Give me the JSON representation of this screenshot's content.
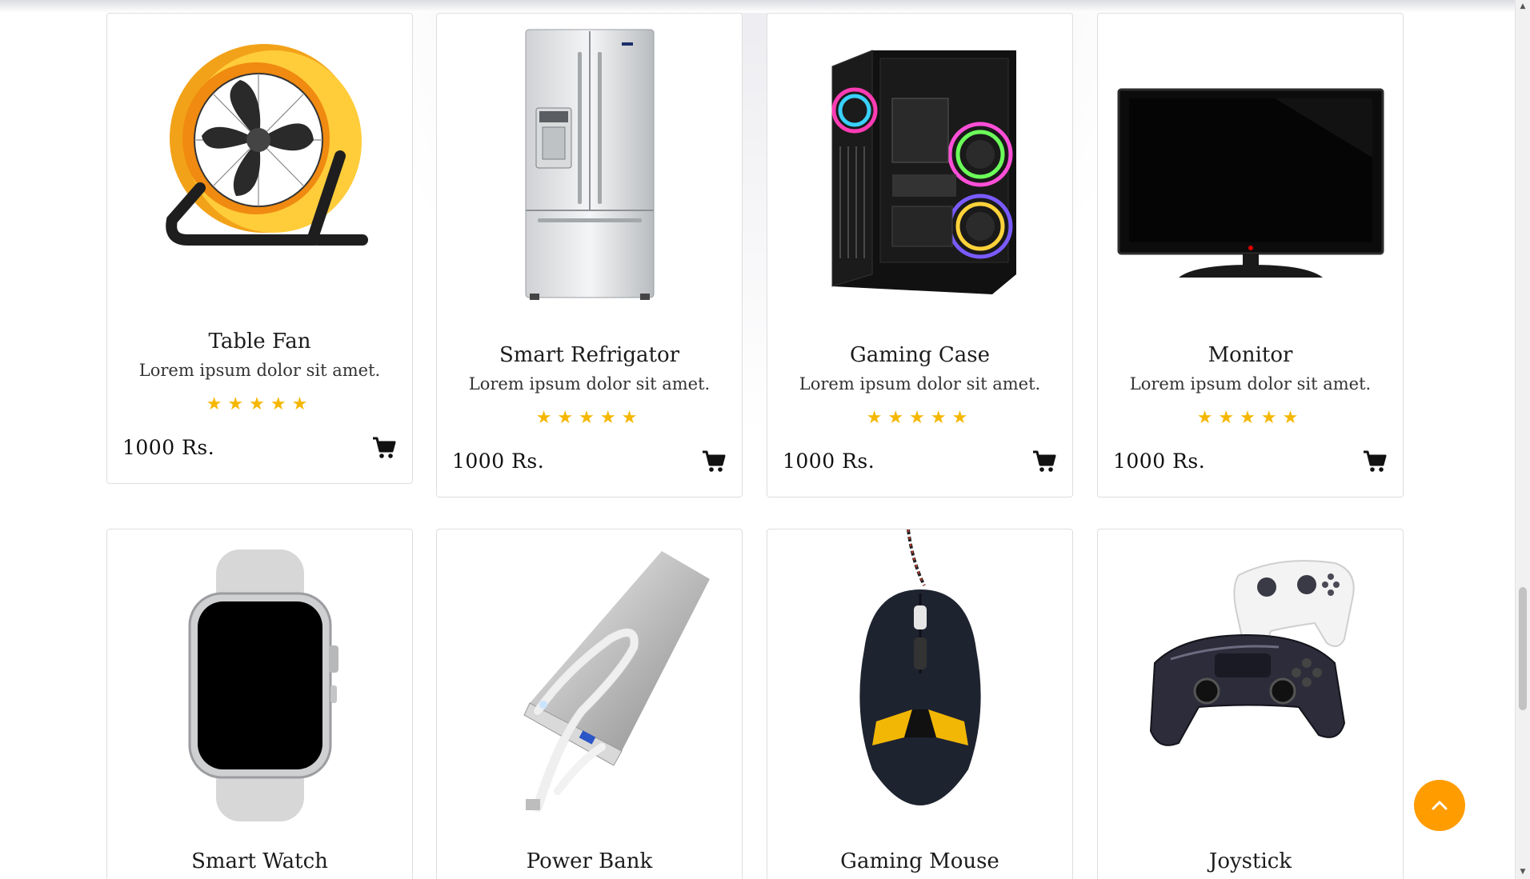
{
  "products": [
    {
      "name": "Table Fan",
      "description": "Lorem ipsum dolor sit amet.",
      "rating": 5,
      "rating_display": "★★★★★",
      "price": "1000 Rs.",
      "image": "table-fan-image"
    },
    {
      "name": "Smart Refrigator",
      "description": "Lorem ipsum dolor sit amet.",
      "rating": 5,
      "rating_display": "★★★★★",
      "price": "1000 Rs.",
      "image": "refrigerator-image"
    },
    {
      "name": "Gaming Case",
      "description": "Lorem ipsum dolor sit amet.",
      "rating": 5,
      "rating_display": "★★★★★",
      "price": "1000 Rs.",
      "image": "gaming-case-image"
    },
    {
      "name": "Monitor",
      "description": "Lorem ipsum dolor sit amet.",
      "rating": 5,
      "rating_display": "★★★★★",
      "price": "1000 Rs.",
      "image": "monitor-image"
    },
    {
      "name": "Smart Watch",
      "image": "smart-watch-image"
    },
    {
      "name": "Power Bank",
      "image": "power-bank-image"
    },
    {
      "name": "Gaming Mouse",
      "image": "gaming-mouse-image"
    },
    {
      "name": "Joystick",
      "image": "joystick-image"
    }
  ],
  "icons": {
    "cart": "shopping-cart-icon",
    "back_to_top": "chevron-up-icon"
  },
  "colors": {
    "star": "#f5b700",
    "accent": "#ff9c00",
    "border": "#dedede"
  }
}
